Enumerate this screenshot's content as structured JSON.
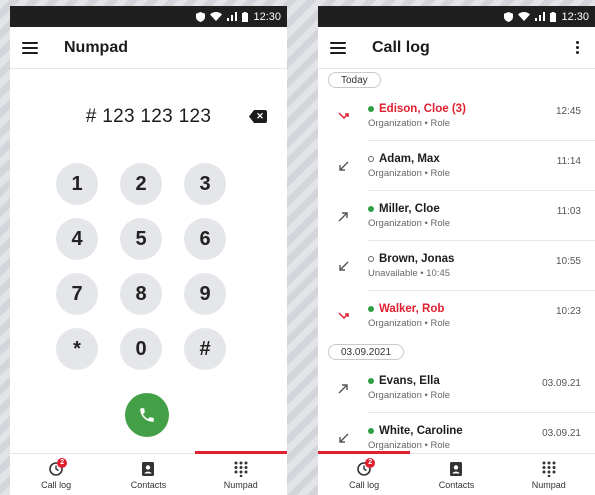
{
  "status_bar": {
    "time": "12:30"
  },
  "numpad_screen": {
    "title": "Numpad",
    "dialed_number": "# 123 123 123",
    "keys": [
      "1",
      "2",
      "3",
      "4",
      "5",
      "6",
      "7",
      "8",
      "9",
      "*",
      "0",
      "#"
    ]
  },
  "call_log_screen": {
    "title": "Call log",
    "groups": [
      {
        "date": "Today",
        "entries": [
          {
            "name": "Edison, Cloe (3)",
            "sub": "Organization • Role",
            "time": "12:45",
            "direction": "missed",
            "presence": "available"
          },
          {
            "name": "Adam, Max",
            "sub": "Organization • Role",
            "time": "11:14",
            "direction": "incoming",
            "presence": "offline"
          },
          {
            "name": "Miller, Cloe",
            "sub": "Organization • Role",
            "time": "11:03",
            "direction": "outgoing",
            "presence": "available"
          },
          {
            "name": "Brown, Jonas",
            "sub": "Unavailable • 10:45",
            "time": "10:55",
            "direction": "incoming",
            "presence": "offline"
          },
          {
            "name": "Walker, Rob",
            "sub": "Organization • Role",
            "time": "10:23",
            "direction": "missed",
            "presence": "available"
          }
        ]
      },
      {
        "date": "03.09.2021",
        "entries": [
          {
            "name": "Evans, Ella",
            "sub": "Organization • Role",
            "time": "03.09.21",
            "direction": "outgoing",
            "presence": "available"
          },
          {
            "name": "White, Caroline",
            "sub": "Organization • Role",
            "time": "03.09.21",
            "direction": "incoming",
            "presence": "available"
          }
        ]
      }
    ]
  },
  "bottom_nav": {
    "items": [
      {
        "label": "Call log",
        "icon": "call-log-icon",
        "badge": "2"
      },
      {
        "label": "Contacts",
        "icon": "contacts-icon"
      },
      {
        "label": "Numpad",
        "icon": "dialpad-icon"
      }
    ]
  },
  "colors": {
    "accent_red": "#e02030",
    "call_green": "#43a047",
    "presence_green": "#2fa046"
  }
}
